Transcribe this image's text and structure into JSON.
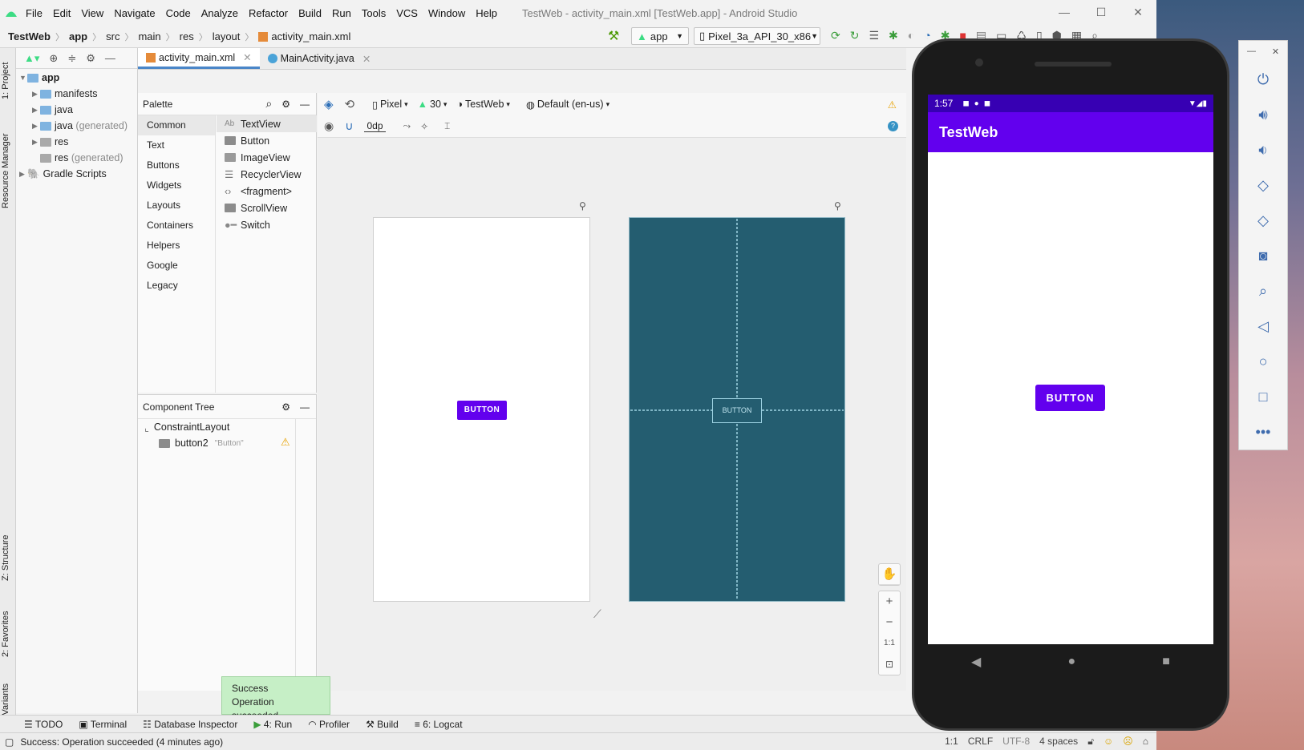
{
  "window": {
    "title": "TestWeb - activity_main.xml [TestWeb.app] - Android Studio",
    "menu": [
      "File",
      "Edit",
      "View",
      "Navigate",
      "Code",
      "Analyze",
      "Refactor",
      "Build",
      "Run",
      "Tools",
      "VCS",
      "Window",
      "Help"
    ],
    "controls": {
      "minimize": "—",
      "maximize": "☐",
      "close": "✕"
    }
  },
  "breadcrumb": [
    "TestWeb",
    "app",
    "src",
    "main",
    "res",
    "layout",
    "activity_main.xml"
  ],
  "toolbar": {
    "run_config": "app",
    "device": "Pixel_3a_API_30_x86"
  },
  "left_strip": {
    "project": "1: Project",
    "resource_manager": "Resource Manager",
    "structure": "Z: Structure",
    "favorites": "2: Favorites",
    "build_variants": "Build Variants"
  },
  "project_tree": [
    {
      "label": "app",
      "suffix": ""
    },
    {
      "label": "manifests",
      "suffix": ""
    },
    {
      "label": "java",
      "suffix": ""
    },
    {
      "label": "java",
      "suffix": "(generated)"
    },
    {
      "label": "res",
      "suffix": ""
    },
    {
      "label": "res",
      "suffix": "(generated)"
    },
    {
      "label": "Gradle Scripts",
      "suffix": ""
    }
  ],
  "editor_tabs": [
    {
      "label": "activity_main.xml",
      "close": "✕"
    },
    {
      "label": "MainActivity.java",
      "close": "✕"
    }
  ],
  "palette": {
    "title": "Palette",
    "categories": [
      "Common",
      "Text",
      "Buttons",
      "Widgets",
      "Layouts",
      "Containers",
      "Helpers",
      "Google",
      "Legacy"
    ],
    "items": [
      "TextView",
      "Button",
      "ImageView",
      "RecyclerView",
      "<fragment>",
      "ScrollView",
      "Switch"
    ],
    "textview_icon": "Ab"
  },
  "design_toolbar": {
    "device": "Pixel",
    "api": "30",
    "theme": "TestWeb",
    "locale": "Default (en-us)",
    "margin": "0dp"
  },
  "component_tree": {
    "title": "Component Tree",
    "root": "ConstraintLayout",
    "child": "button2",
    "child_text": "\"Button\""
  },
  "design": {
    "button_label": "BUTTON",
    "blueprint_button_label": "BUTTON"
  },
  "zoom": {
    "plus": "+",
    "minus": "−",
    "one_to_one": "1:1"
  },
  "bottom_tools": [
    {
      "label": "TODO",
      "icon": "list-icon"
    },
    {
      "label": "Terminal",
      "icon": "terminal-icon"
    },
    {
      "label": "Database Inspector",
      "icon": "database-icon"
    },
    {
      "label": "4: Run",
      "icon": "run-icon"
    },
    {
      "label": "Profiler",
      "icon": "profiler-icon"
    },
    {
      "label": "Build",
      "icon": "hammer-icon"
    },
    {
      "label": "6: Logcat",
      "icon": "logcat-icon"
    }
  ],
  "toast": {
    "title": "Success",
    "message": "Operation succeeded"
  },
  "status": {
    "message": "Success: Operation succeeded (4 minutes ago)",
    "position": "1:1",
    "line_ending": "CRLF",
    "encoding": "UTF-8",
    "indent": "4 spaces"
  },
  "emulator": {
    "time": "1:57",
    "app_title": "TestWeb",
    "button_label": "BUTTON",
    "panel_more": "•••"
  },
  "colors": {
    "primary": "#6200ee",
    "primary_dark": "#3700b3",
    "blueprint": "#245d70"
  }
}
